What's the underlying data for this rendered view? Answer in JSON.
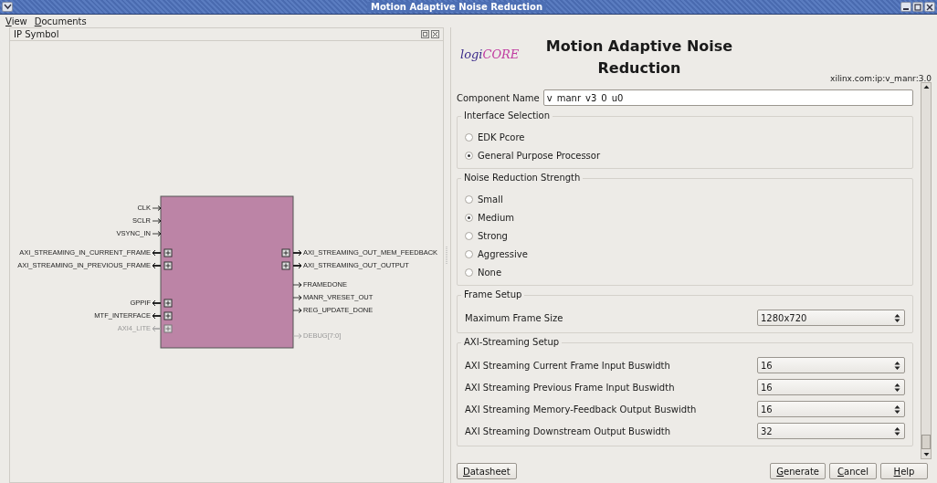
{
  "window": {
    "title": "Motion Adaptive Noise Reduction"
  },
  "menu": [
    "View",
    "Documents"
  ],
  "symbol_panel": {
    "title": "IP Symbol",
    "left_pins": [
      {
        "name": "CLK",
        "kind": "wire",
        "disabled": false
      },
      {
        "name": "SCLR",
        "kind": "wire",
        "disabled": false
      },
      {
        "name": "VSYNC_IN",
        "kind": "wire",
        "disabled": false
      },
      {
        "name": "AXI_STREAMING_IN_CURRENT_FRAME",
        "kind": "bus",
        "disabled": false
      },
      {
        "name": "AXI_STREAMING_IN_PREVIOUS_FRAME",
        "kind": "bus",
        "disabled": false
      },
      {
        "name": "GPPIF",
        "kind": "bus",
        "disabled": false
      },
      {
        "name": "MTF_INTERFACE",
        "kind": "bus",
        "disabled": false
      },
      {
        "name": "AXI4_LITE",
        "kind": "bus",
        "disabled": true
      }
    ],
    "right_pins": [
      {
        "name": "AXI_STREAMING_OUT_MEM_FEEDBACK",
        "kind": "bus",
        "disabled": false
      },
      {
        "name": "AXI_STREAMING_OUT_OUTPUT",
        "kind": "bus",
        "disabled": false
      },
      {
        "name": "FRAMEDONE",
        "kind": "wire",
        "disabled": false
      },
      {
        "name": "MANR_VRESET_OUT",
        "kind": "wire",
        "disabled": false
      },
      {
        "name": "REG_UPDATE_DONE",
        "kind": "wire",
        "disabled": false
      },
      {
        "name": "DEBUG[7:0]",
        "kind": "wire",
        "disabled": true
      }
    ]
  },
  "header": {
    "logo": "logiCORE",
    "title": "Motion Adaptive Noise Reduction",
    "core_id": "xilinx.com:ip:v_manr:3.0"
  },
  "component_name": {
    "label": "Component Name",
    "value": "v_manr_v3_0_u0"
  },
  "groups": [
    {
      "title": "Interface Selection",
      "kind": "radio",
      "options": [
        {
          "label": "EDK Pcore",
          "selected": false
        },
        {
          "label": "General Purpose Processor",
          "selected": true
        }
      ]
    },
    {
      "title": "Noise Reduction Strength",
      "kind": "radio",
      "options": [
        {
          "label": "Small",
          "selected": false
        },
        {
          "label": "Medium",
          "selected": true
        },
        {
          "label": "Strong",
          "selected": false
        },
        {
          "label": "Aggressive",
          "selected": false
        },
        {
          "label": "None",
          "selected": false
        }
      ]
    },
    {
      "title": "Frame Setup",
      "kind": "select",
      "rows": [
        {
          "label": "Maximum Frame Size",
          "value": "1280x720"
        }
      ]
    },
    {
      "title": "AXI-Streaming Setup",
      "kind": "select",
      "rows": [
        {
          "label": "AXI Streaming Current Frame Input Buswidth",
          "value": "16"
        },
        {
          "label": "AXI Streaming Previous Frame Input Buswidth",
          "value": "16"
        },
        {
          "label": "AXI Streaming Memory-Feedback Output Buswidth",
          "value": "16"
        },
        {
          "label": "AXI Streaming Downstream Output Buswidth",
          "value": "32"
        }
      ]
    }
  ],
  "buttons_left": [
    "Datasheet"
  ],
  "buttons_right": [
    "Generate",
    "Cancel",
    "Help"
  ]
}
